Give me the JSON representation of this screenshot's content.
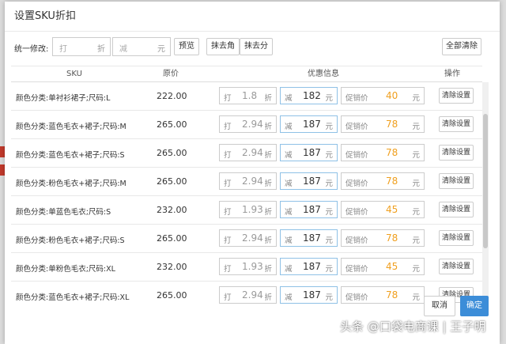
{
  "dialog": {
    "title": "设置SKU折扣"
  },
  "toolbar": {
    "label": "统一修改:",
    "discount_prefix": "打",
    "discount_suffix": "折",
    "reduce_prefix": "减",
    "reduce_suffix": "元",
    "preview": "预览",
    "round_jiao": "抹去角",
    "round_fen": "抹去分",
    "clear_all": "全部清除"
  },
  "table": {
    "headers": {
      "sku": "SKU",
      "price": "原价",
      "offer": "优惠信息",
      "action": "操作"
    },
    "discount_prefix": "打",
    "discount_suffix": "折",
    "reduce_prefix": "减",
    "reduce_suffix": "元",
    "promo_prefix": "促销价",
    "promo_suffix": "元",
    "clear_label": "清除设置",
    "rows": [
      {
        "sku": "颜色分类:单衬衫裙子;尺码:L",
        "price": "222.00",
        "discount": "1.8",
        "reduce": "182",
        "promo": "40"
      },
      {
        "sku": "颜色分类:蓝色毛衣+裙子;尺码:M",
        "price": "265.00",
        "discount": "2.94",
        "reduce": "187",
        "promo": "78"
      },
      {
        "sku": "颜色分类:蓝色毛衣+裙子;尺码:S",
        "price": "265.00",
        "discount": "2.94",
        "reduce": "187",
        "promo": "78"
      },
      {
        "sku": "颜色分类:粉色毛衣+裙子;尺码:M",
        "price": "265.00",
        "discount": "2.94",
        "reduce": "187",
        "promo": "78"
      },
      {
        "sku": "颜色分类:单蓝色毛衣;尺码:S",
        "price": "232.00",
        "discount": "1.93",
        "reduce": "187",
        "promo": "45"
      },
      {
        "sku": "颜色分类:粉色毛衣+裙子;尺码:S",
        "price": "265.00",
        "discount": "2.94",
        "reduce": "187",
        "promo": "78"
      },
      {
        "sku": "颜色分类:单粉色毛衣;尺码:XL",
        "price": "232.00",
        "discount": "1.93",
        "reduce": "187",
        "promo": "45"
      },
      {
        "sku": "颜色分类:蓝色毛衣+裙子;尺码:XL",
        "price": "265.00",
        "discount": "2.94",
        "reduce": "187",
        "promo": "78"
      }
    ]
  },
  "footer": {
    "cancel": "取消",
    "ok": "确定"
  },
  "watermark": "头条 @口袋电商课 | 王子明",
  "colors": {
    "promo": "#f0a020",
    "primary": "#3c8dd8"
  }
}
